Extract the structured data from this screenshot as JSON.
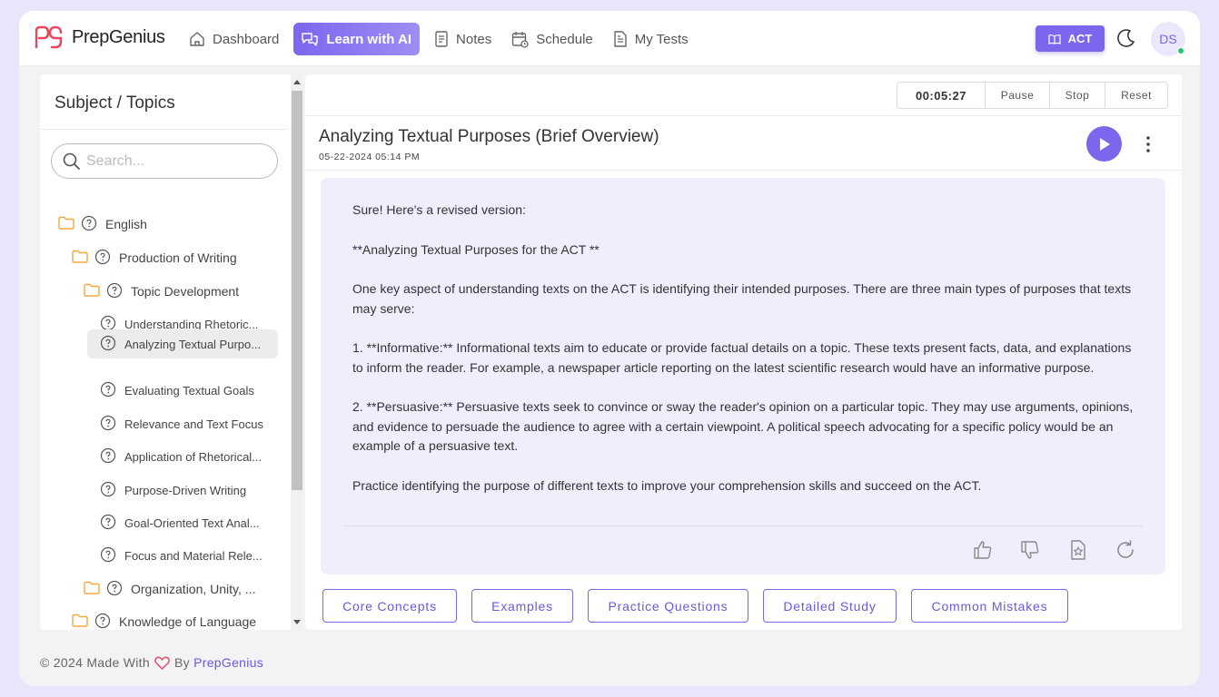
{
  "brand": {
    "name": "PrepGenius"
  },
  "nav": {
    "items": [
      {
        "label": "Dashboard",
        "icon": "home-icon",
        "active": false
      },
      {
        "label": "Learn with AI",
        "icon": "chat-icon",
        "active": true
      },
      {
        "label": "Notes",
        "icon": "notes-icon",
        "active": false
      },
      {
        "label": "Schedule",
        "icon": "calendar-icon",
        "active": false
      },
      {
        "label": "My Tests",
        "icon": "tests-icon",
        "active": false
      }
    ],
    "exam_label": "ACT",
    "avatar_initials": "DS",
    "accent_color": "#7b66ee"
  },
  "sidebar": {
    "title": "Subject / Topics",
    "search_placeholder": "Search...",
    "tree": [
      {
        "label": "English",
        "type": "folder"
      },
      {
        "label": "Production of Writing",
        "type": "folder"
      },
      {
        "label": "Topic Development",
        "type": "folder"
      },
      {
        "label": "Understanding Rhetoric...",
        "type": "topic"
      },
      {
        "label": "Analyzing Textual Purpo...",
        "type": "topic",
        "selected": true
      },
      {
        "label": "Evaluating Textual Goals",
        "type": "topic"
      },
      {
        "label": "Relevance and Text Focus",
        "type": "topic"
      },
      {
        "label": "Application of Rhetorical...",
        "type": "topic"
      },
      {
        "label": "Purpose-Driven Writing",
        "type": "topic"
      },
      {
        "label": "Goal-Oriented Text Anal...",
        "type": "topic"
      },
      {
        "label": "Focus and Material Rele...",
        "type": "topic"
      },
      {
        "label": "Organization, Unity, ...",
        "type": "folder"
      },
      {
        "label": "Knowledge of Language",
        "type": "folder"
      }
    ]
  },
  "timer": {
    "value": "00:05:27",
    "pause": "Pause",
    "stop": "Stop",
    "reset": "Reset"
  },
  "document": {
    "title": "Analyzing Textual Purposes (Brief Overview)",
    "date": "05-22-2024 05:14 PM",
    "paragraphs": [
      "Sure! Here's a revised version:",
      "**Analyzing Textual Purposes for the ACT **",
      "One key aspect of understanding texts on the ACT is identifying their intended purposes. There are three main types of purposes that texts may serve:",
      "1. **Informative:** Informational texts aim to educate or provide factual details on a topic. These texts present facts, data, and explanations to inform the reader. For example, a newspaper article reporting on the latest scientific research would have an informative purpose.",
      "2. **Persuasive:** Persuasive texts seek to convince or sway the reader's opinion on a particular topic. They may use arguments, opinions, and evidence to persuade the audience to agree with a certain viewpoint. A political speech advocating for a specific policy would be an example of a persuasive text.",
      "Practice identifying the purpose of different texts to improve your comprehension skills and succeed on the ACT."
    ]
  },
  "chips": [
    "Core Concepts",
    "Examples",
    "Practice Questions",
    "Detailed Study",
    "Common Mistakes"
  ],
  "footer": {
    "prefix": "© 2024 Made With",
    "by": "By",
    "brand": "PrepGenius"
  }
}
